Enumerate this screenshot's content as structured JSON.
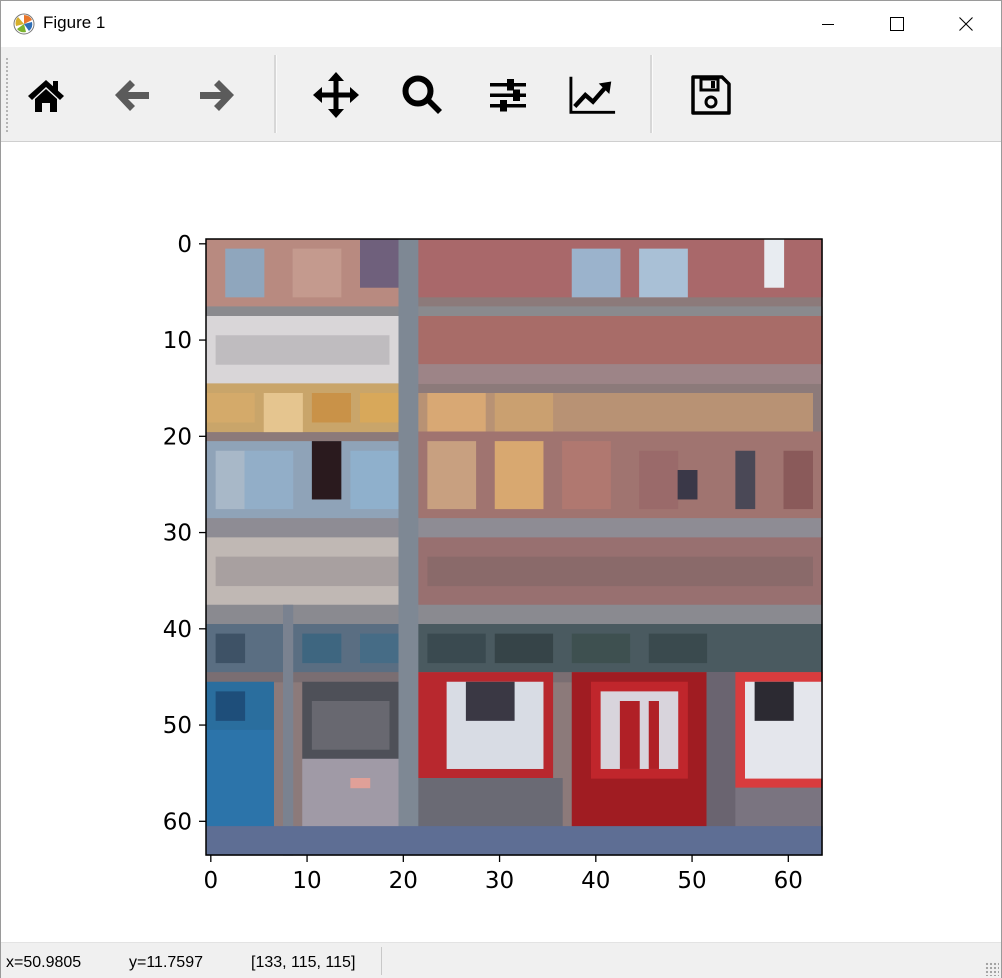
{
  "window": {
    "title": "Figure 1"
  },
  "toolbar": {
    "buttons": [
      {
        "name": "home",
        "icon": "home-icon"
      },
      {
        "name": "back",
        "icon": "arrow-left-icon"
      },
      {
        "name": "forward",
        "icon": "arrow-right-icon"
      },
      {
        "name": "pan",
        "icon": "move-icon"
      },
      {
        "name": "zoom",
        "icon": "magnifier-icon"
      },
      {
        "name": "configure-subplots",
        "icon": "sliders-icon"
      },
      {
        "name": "edit-axes",
        "icon": "line-chart-icon"
      },
      {
        "name": "save",
        "icon": "floppy-disk-icon"
      }
    ]
  },
  "plot": {
    "image_size": 64,
    "x_ticks": [
      "0",
      "10",
      "20",
      "30",
      "40",
      "50",
      "60"
    ],
    "y_ticks": [
      "0",
      "10",
      "20",
      "30",
      "40",
      "50",
      "60"
    ],
    "xlim": [
      -0.5,
      63.5
    ],
    "ylim": [
      63.5,
      -0.5
    ]
  },
  "status": {
    "x_readout": "x=50.9805",
    "y_readout": "y=11.7597",
    "pixel_value": "[133, 115, 115]"
  }
}
